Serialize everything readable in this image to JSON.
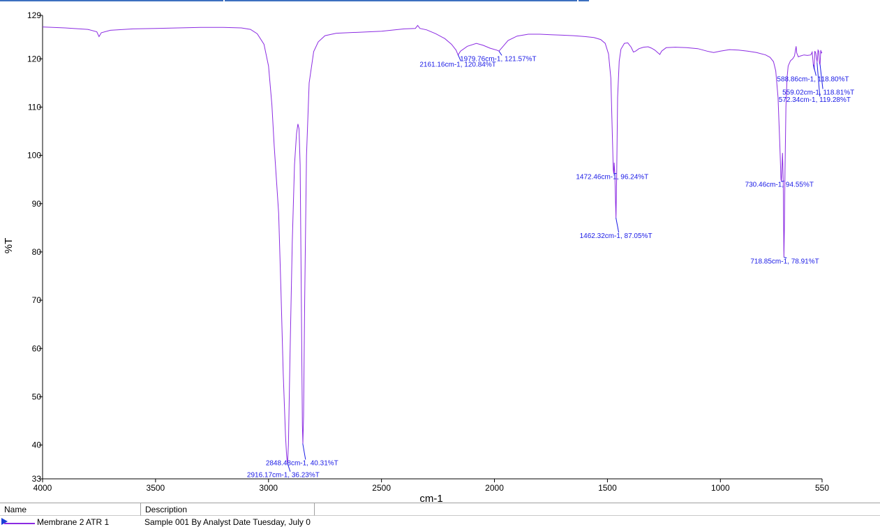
{
  "chart_data": {
    "type": "line",
    "title": "",
    "xlabel": "cm-1",
    "ylabel": "%T",
    "xlim": [
      4000,
      550
    ],
    "ylim": [
      33,
      129
    ],
    "x_reversed": true,
    "x_ticks": [
      4000,
      3500,
      3000,
      2500,
      2000,
      1500,
      1000,
      550
    ],
    "y_ticks": [
      129,
      120,
      110,
      100,
      90,
      80,
      70,
      60,
      50,
      40,
      33
    ],
    "grid": false,
    "line_color": "#8b2be2",
    "label_color": "#1a1ae6",
    "series": [
      {
        "name": "Membrane 2 ATR 1",
        "points": [
          [
            4000,
            126.6
          ],
          [
            3900,
            126.4
          ],
          [
            3800,
            126.1
          ],
          [
            3760,
            125.6
          ],
          [
            3750,
            124.6
          ],
          [
            3740,
            125.4
          ],
          [
            3700,
            125.9
          ],
          [
            3600,
            126.2
          ],
          [
            3500,
            126.3
          ],
          [
            3400,
            126.4
          ],
          [
            3300,
            126.5
          ],
          [
            3200,
            126.5
          ],
          [
            3120,
            126.4
          ],
          [
            3080,
            126.1
          ],
          [
            3050,
            125.2
          ],
          [
            3020,
            123.0
          ],
          [
            3000,
            118.5
          ],
          [
            2985,
            110.5
          ],
          [
            2975,
            102.0
          ],
          [
            2965,
            95.0
          ],
          [
            2955,
            88.0
          ],
          [
            2945,
            72.0
          ],
          [
            2935,
            55.0
          ],
          [
            2925,
            42.0
          ],
          [
            2920,
            37.8
          ],
          [
            2916,
            36.2
          ],
          [
            2912,
            40.0
          ],
          [
            2905,
            58.0
          ],
          [
            2895,
            82.0
          ],
          [
            2885,
            98.0
          ],
          [
            2876,
            104.5
          ],
          [
            2870,
            106.5
          ],
          [
            2865,
            105.5
          ],
          [
            2860,
            98.0
          ],
          [
            2855,
            72.0
          ],
          [
            2850,
            44.0
          ],
          [
            2848,
            40.3
          ],
          [
            2845,
            46.0
          ],
          [
            2840,
            70.0
          ],
          [
            2832,
            100.0
          ],
          [
            2820,
            115.0
          ],
          [
            2800,
            121.5
          ],
          [
            2780,
            123.5
          ],
          [
            2750,
            124.8
          ],
          [
            2700,
            125.3
          ],
          [
            2600,
            125.5
          ],
          [
            2500,
            125.7
          ],
          [
            2400,
            126.2
          ],
          [
            2350,
            126.3
          ],
          [
            2340,
            126.9
          ],
          [
            2330,
            126.3
          ],
          [
            2300,
            126.0
          ],
          [
            2260,
            125.2
          ],
          [
            2220,
            124.2
          ],
          [
            2190,
            123.0
          ],
          [
            2170,
            121.8
          ],
          [
            2161,
            120.8
          ],
          [
            2150,
            121.6
          ],
          [
            2120,
            122.6
          ],
          [
            2080,
            123.2
          ],
          [
            2050,
            122.8
          ],
          [
            2020,
            122.2
          ],
          [
            1990,
            121.8
          ],
          [
            1980,
            121.6
          ],
          [
            1965,
            122.4
          ],
          [
            1940,
            123.8
          ],
          [
            1900,
            124.7
          ],
          [
            1850,
            125.1
          ],
          [
            1800,
            125.1
          ],
          [
            1750,
            125.0
          ],
          [
            1700,
            124.9
          ],
          [
            1650,
            124.8
          ],
          [
            1600,
            124.6
          ],
          [
            1560,
            124.4
          ],
          [
            1530,
            124.0
          ],
          [
            1510,
            123.2
          ],
          [
            1495,
            121.0
          ],
          [
            1485,
            116.0
          ],
          [
            1478,
            104.0
          ],
          [
            1474,
            97.0
          ],
          [
            1472,
            96.2
          ],
          [
            1470,
            98.5
          ],
          [
            1467,
            96.0
          ],
          [
            1464,
            90.0
          ],
          [
            1462,
            87.0
          ],
          [
            1459,
            96.0
          ],
          [
            1455,
            112.0
          ],
          [
            1448,
            119.5
          ],
          [
            1440,
            122.0
          ],
          [
            1425,
            123.2
          ],
          [
            1410,
            123.3
          ],
          [
            1395,
            122.4
          ],
          [
            1385,
            121.4
          ],
          [
            1375,
            121.6
          ],
          [
            1360,
            122.1
          ],
          [
            1340,
            122.4
          ],
          [
            1320,
            122.5
          ],
          [
            1305,
            122.2
          ],
          [
            1290,
            121.8
          ],
          [
            1280,
            121.4
          ],
          [
            1268,
            120.9
          ],
          [
            1260,
            121.6
          ],
          [
            1240,
            122.3
          ],
          [
            1200,
            122.4
          ],
          [
            1150,
            122.3
          ],
          [
            1100,
            122.1
          ],
          [
            1060,
            121.6
          ],
          [
            1030,
            121.3
          ],
          [
            1000,
            121.6
          ],
          [
            960,
            121.9
          ],
          [
            920,
            121.8
          ],
          [
            880,
            121.6
          ],
          [
            840,
            121.3
          ],
          [
            800,
            120.8
          ],
          [
            780,
            120.3
          ],
          [
            765,
            119.4
          ],
          [
            755,
            117.5
          ],
          [
            745,
            112.0
          ],
          [
            737,
            102.0
          ],
          [
            732,
            95.0
          ],
          [
            730,
            94.6
          ],
          [
            728,
            97.0
          ],
          [
            725,
            100.5
          ],
          [
            722,
            95.0
          ],
          [
            720,
            84.0
          ],
          [
            719,
            78.9
          ],
          [
            717,
            84.0
          ],
          [
            714,
            97.0
          ],
          [
            710,
            110.0
          ],
          [
            705,
            116.0
          ],
          [
            700,
            118.5
          ],
          [
            690,
            119.6
          ],
          [
            680,
            120.0
          ],
          [
            672,
            120.6
          ],
          [
            665,
            122.6
          ],
          [
            662,
            121.2
          ],
          [
            655,
            120.4
          ],
          [
            645,
            120.6
          ],
          [
            630,
            120.8
          ],
          [
            615,
            120.7
          ],
          [
            600,
            120.8
          ],
          [
            594,
            121.4
          ],
          [
            589,
            118.8
          ],
          [
            585,
            117.8
          ],
          [
            582,
            121.6
          ],
          [
            578,
            121.2
          ],
          [
            572,
            119.3
          ],
          [
            568,
            121.8
          ],
          [
            565,
            121.6
          ],
          [
            561,
            119.0
          ],
          [
            559,
            118.8
          ],
          [
            556,
            121.8
          ],
          [
            553,
            121.2
          ],
          [
            550,
            121.4
          ]
        ]
      }
    ],
    "annotations": [
      {
        "text": "2916.17cm-1, 36.23%T",
        "x": 2916.17,
        "y": 36.23
      },
      {
        "text": "2848.48cm-1, 40.31%T",
        "x": 2848.48,
        "y": 40.31
      },
      {
        "text": "2161.16cm-1, 120.84%T",
        "x": 2161.16,
        "y": 120.84
      },
      {
        "text": "1979.76cm-1, 121.57%T",
        "x": 1979.76,
        "y": 121.57
      },
      {
        "text": "1472.46cm-1, 96.24%T",
        "x": 1472.46,
        "y": 96.24
      },
      {
        "text": "1462.32cm-1, 87.05%T",
        "x": 1462.32,
        "y": 87.05
      },
      {
        "text": "730.46cm-1, 94.55%T",
        "x": 730.46,
        "y": 94.55
      },
      {
        "text": "718.85cm-1, 78.91%T",
        "x": 718.85,
        "y": 78.91
      },
      {
        "text": "588.86cm-1, 118.80%T",
        "x": 588.86,
        "y": 118.8
      },
      {
        "text": "559.02cm-1, 118.81%T",
        "x": 559.02,
        "y": 118.81
      },
      {
        "text": "572.34cm-1, 119.28%T",
        "x": 572.34,
        "y": 119.28
      }
    ]
  },
  "legend": {
    "headers": {
      "name": "Name",
      "description": "Description"
    },
    "row": {
      "name": "Membrane 2 ATR 1",
      "description": "Sample 001 By Analyst Date Tuesday, July 0"
    }
  }
}
